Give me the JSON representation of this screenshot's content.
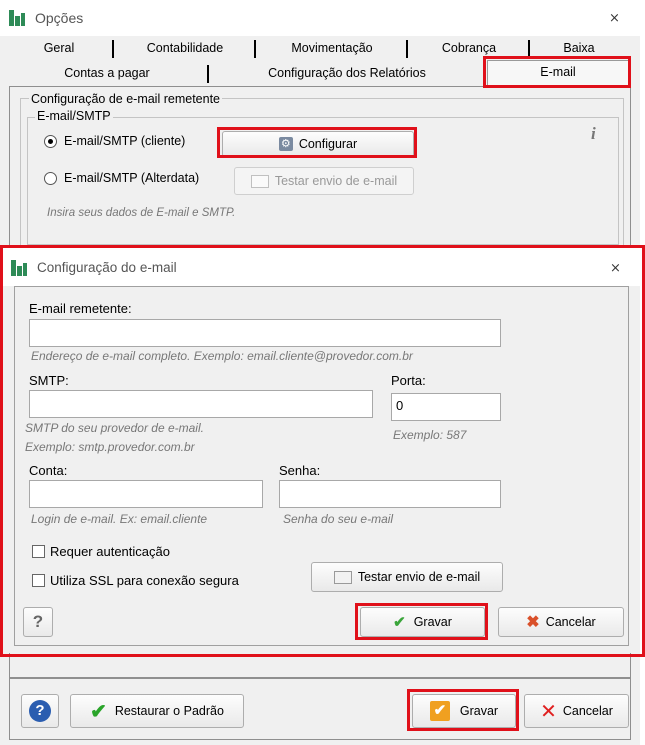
{
  "window": {
    "title": "Opções",
    "close_glyph": "⨯"
  },
  "tabs_row1": [
    "Geral",
    "Contabilidade",
    "Movimentação",
    "Cobrança",
    "Baixa"
  ],
  "tabs_row2": [
    "Contas a pagar",
    "Configuração dos Relatórios",
    "E-mail"
  ],
  "email_section": {
    "group_title": "Configuração de e-mail remetente",
    "sub_group_title": "E-mail/SMTP",
    "radio_cliente": "E-mail/SMTP (cliente)",
    "radio_alterdata": "E-mail/SMTP (Alterdata)",
    "configure_button": "Configurar",
    "test_button": "Testar envio de e-mail",
    "hint": "Insira seus dados de E-mail e SMTP.",
    "info_glyph": "i",
    "selected_radio": "cliente"
  },
  "dialog": {
    "title": "Configuração do e-mail",
    "close_glyph": "⨯",
    "sender_label": "E-mail remetente:",
    "sender_value": "",
    "sender_hint": "Endereço de e-mail completo. Exemplo: email.cliente@provedor.com.br",
    "smtp_label": "SMTP:",
    "smtp_value": "",
    "smtp_hint1": "SMTP do seu provedor de e-mail.",
    "smtp_hint2": "Exemplo:  smtp.provedor.com.br",
    "port_label": "Porta:",
    "port_value": "0",
    "port_hint": "Exemplo: 587",
    "account_label": "Conta:",
    "account_value": "",
    "account_hint": "Login de e-mail. Ex: email.cliente",
    "password_label": "Senha:",
    "password_value": "",
    "password_hint": "Senha do seu e-mail",
    "auth_checkbox": "Requer autenticação",
    "ssl_checkbox": "Utiliza SSL para conexão segura",
    "test_button": "Testar envio de e-mail",
    "help_button": "?",
    "save_button": "Gravar",
    "cancel_button": "Cancelar"
  },
  "footer": {
    "help_glyph": "?",
    "restore_button": "Restaurar o Padrão",
    "save_button": "Gravar",
    "cancel_button": "Cancelar"
  },
  "colors": {
    "highlight": "#e0101a",
    "brand_green": "#2e8b57",
    "panel_bg": "#f0f0f0"
  }
}
